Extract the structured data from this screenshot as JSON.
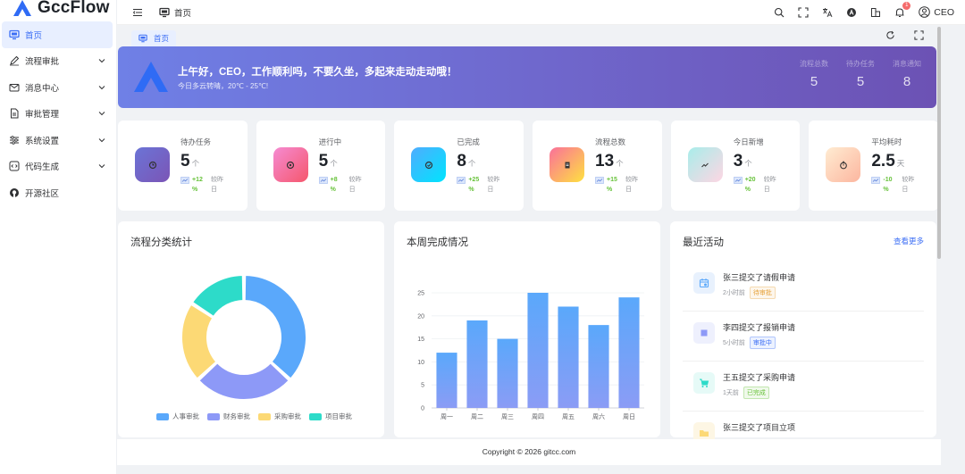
{
  "app": {
    "name": "GccFlow"
  },
  "sidebar": {
    "items": [
      {
        "label": "首页",
        "icon": "monitor-icon",
        "active": true
      },
      {
        "label": "流程审批",
        "icon": "pen-icon"
      },
      {
        "label": "消息中心",
        "icon": "mail-icon"
      },
      {
        "label": "审批管理",
        "icon": "document-icon"
      },
      {
        "label": "系统设置",
        "icon": "sliders-icon"
      },
      {
        "label": "代码生成",
        "icon": "code-icon"
      },
      {
        "label": "开源社区",
        "icon": "github-icon"
      }
    ]
  },
  "header": {
    "breadcrumb": "首页",
    "notification_count": "1",
    "user": "CEO"
  },
  "tabs": [
    {
      "label": "首页"
    }
  ],
  "banner": {
    "greeting": "上午好，CEO，工作顺利吗，不要久坐，多起来走动走动哦！",
    "weather": "今日多云转晴，20℃ - 25℃!",
    "stats": [
      {
        "label": "流程总数",
        "value": "5"
      },
      {
        "label": "待办任务",
        "value": "5"
      },
      {
        "label": "消息通知",
        "value": "8"
      }
    ]
  },
  "cards": [
    {
      "label": "待办任务",
      "value": "5",
      "unit": "个",
      "trend": "+12 %",
      "compare": "较昨日",
      "color_from": "#6b74d6",
      "color_to": "#7b55b6"
    },
    {
      "label": "进行中",
      "value": "5",
      "unit": "个",
      "trend": "+8 %",
      "compare": "较昨日",
      "color_from": "#f58bd2",
      "color_to": "#f5576c"
    },
    {
      "label": "已完成",
      "value": "8",
      "unit": "个",
      "trend": "+25 %",
      "compare": "较昨日",
      "color_from": "#4facfe",
      "color_to": "#00e4fe"
    },
    {
      "label": "流程总数",
      "value": "13",
      "unit": "个",
      "trend": "+15 %",
      "compare": "较昨日",
      "color_from": "#fa709a",
      "color_to": "#fee140"
    },
    {
      "label": "今日新增",
      "value": "3",
      "unit": "个",
      "trend": "+20 %",
      "compare": "较昨日",
      "color_from": "#a8edea",
      "color_to": "#fed6e3"
    },
    {
      "label": "平均耗时",
      "value": "2.5",
      "unit": "天",
      "trend": "-10 %",
      "compare": "较昨日",
      "color_from": "#ffecd2",
      "color_to": "#fcb69f"
    }
  ],
  "panels": {
    "category_title": "流程分类统计",
    "weekly_title": "本周完成情况",
    "activity_title": "最近活动",
    "more_link": "查看更多"
  },
  "chart_data": [
    {
      "type": "pie",
      "title": "流程分类统计",
      "donut": true,
      "categories": [
        "人事审批",
        "财务审批",
        "采购审批",
        "项目审批"
      ],
      "values": [
        35,
        25,
        20,
        15
      ],
      "colors": [
        "#5aa8fb",
        "#8d99f7",
        "#fcd975",
        "#2ddbc9"
      ]
    },
    {
      "type": "bar",
      "title": "本周完成情况",
      "categories": [
        "周一",
        "周二",
        "周三",
        "周四",
        "周五",
        "周六",
        "周日"
      ],
      "values": [
        12,
        19,
        15,
        25,
        22,
        18,
        24
      ],
      "ylim": [
        0,
        25
      ],
      "yticks": [
        0,
        5,
        10,
        15,
        20,
        25
      ],
      "grid": true
    }
  ],
  "activities": [
    {
      "title": "张三提交了请假申请",
      "time": "2小时前",
      "status": "待审批",
      "icon": "calendar-icon",
      "bg": "#e8f1fd",
      "fg": "#5aa8fb",
      "tag_color": "#e6a23c",
      "tag_bg": "#fdf6ec"
    },
    {
      "title": "李四提交了报销申请",
      "time": "5小时前",
      "status": "审批中",
      "icon": "square-icon",
      "bg": "#eef0fd",
      "fg": "#8d99f7",
      "tag_color": "#3b6ef5",
      "tag_bg": "#ecf2ff"
    },
    {
      "title": "王五提交了采购申请",
      "time": "1天前",
      "status": "已完成",
      "icon": "cart-icon",
      "bg": "#e6faf7",
      "fg": "#2ddbc9",
      "tag_color": "#67c23a",
      "tag_bg": "#f0f9eb"
    },
    {
      "title": "张三提交了项目立项",
      "time": "",
      "status": "",
      "icon": "folder-icon",
      "bg": "#fdf6e4",
      "fg": "#fcd975",
      "tag_color": "#3b6ef5",
      "tag_bg": "#ecf2ff"
    }
  ],
  "footer": {
    "copyright": "Copyright © 2026 gitcc.com"
  }
}
